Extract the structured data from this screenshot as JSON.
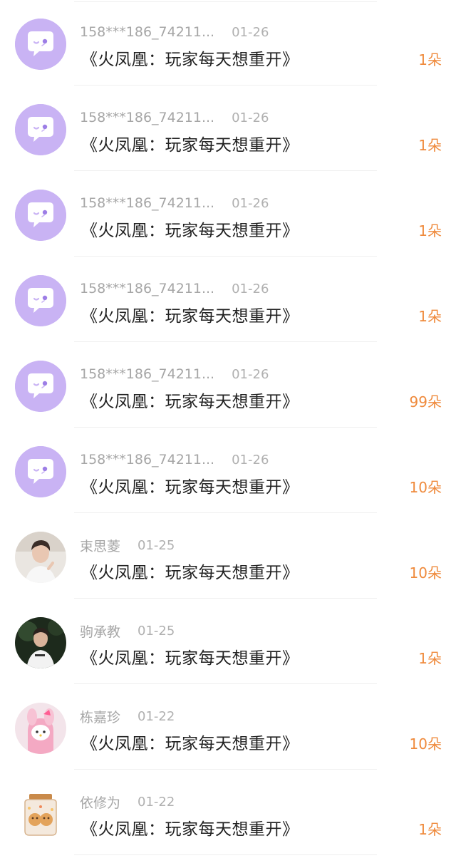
{
  "items": [
    {
      "name": "158***186_74211...",
      "date": "01-26",
      "title": "《火凤凰：玩家每天想重开》",
      "count": "1朵",
      "avatar": "placeholder-icon"
    },
    {
      "name": "158***186_74211...",
      "date": "01-26",
      "title": "《火凤凰：玩家每天想重开》",
      "count": "1朵",
      "avatar": "placeholder-icon"
    },
    {
      "name": "158***186_74211...",
      "date": "01-26",
      "title": "《火凤凰：玩家每天想重开》",
      "count": "1朵",
      "avatar": "placeholder-icon"
    },
    {
      "name": "158***186_74211...",
      "date": "01-26",
      "title": "《火凤凰：玩家每天想重开》",
      "count": "1朵",
      "avatar": "placeholder-icon"
    },
    {
      "name": "158***186_74211...",
      "date": "01-26",
      "title": "《火凤凰：玩家每天想重开》",
      "count": "99朵",
      "avatar": "placeholder-icon"
    },
    {
      "name": "158***186_74211...",
      "date": "01-26",
      "title": "《火凤凰：玩家每天想重开》",
      "count": "10朵",
      "avatar": "placeholder-icon"
    },
    {
      "name": "束思菱",
      "date": "01-25",
      "title": "《火凤凰：玩家每天想重开》",
      "count": "10朵",
      "avatar": "photo-person-light"
    },
    {
      "name": "驹承教",
      "date": "01-25",
      "title": "《火凤凰：玩家每天想重开》",
      "count": "1朵",
      "avatar": "photo-person-dark"
    },
    {
      "name": "栋嘉珍",
      "date": "01-22",
      "title": "《火凤凰：玩家每天想重开》",
      "count": "10朵",
      "avatar": "photo-pink-toy"
    },
    {
      "name": "依修为",
      "date": "01-22",
      "title": "《火凤凰：玩家每天想重开》",
      "count": "1朵",
      "avatar": "photo-jar"
    }
  ],
  "colors": {
    "placeholder_avatar": "#c9b3f4",
    "count_text": "#ef8a3c",
    "meta_text": "#a9a9a9",
    "title_text": "#222222"
  }
}
